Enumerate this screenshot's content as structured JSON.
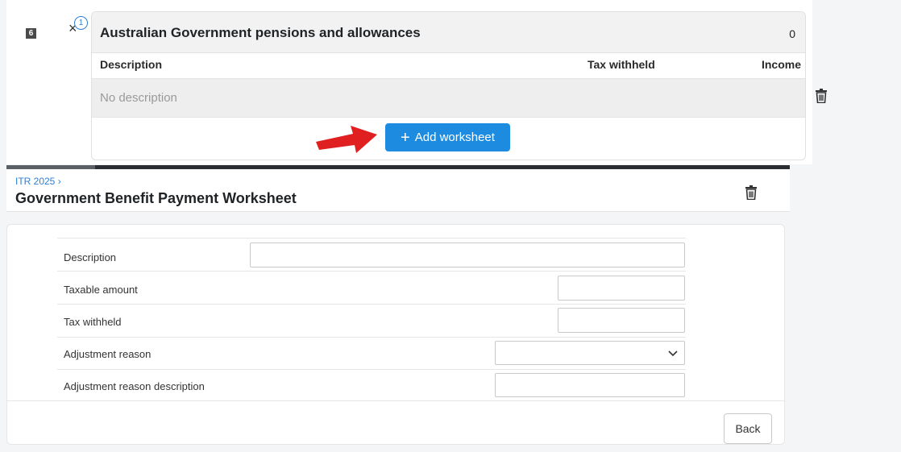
{
  "section": {
    "row_number": "6",
    "x_mark": "×",
    "badge_count": "1",
    "title": "Australian Government pensions and allowances",
    "total": "0",
    "columns": [
      "Description",
      "Tax withheld",
      "Income"
    ],
    "empty_text": "No description",
    "add_button": "+ Add worksheet",
    "add_button_plus": "+",
    "add_button_text": "Add worksheet"
  },
  "worksheet": {
    "breadcrumb": "ITR 2025 ›",
    "title": "Government Benefit Payment Worksheet",
    "fields": [
      {
        "label": "Description",
        "value": ""
      },
      {
        "label": "Taxable amount",
        "value": ""
      },
      {
        "label": "Tax withheld",
        "value": ""
      },
      {
        "label": "Adjustment reason",
        "value": ""
      },
      {
        "label": "Adjustment reason description",
        "value": ""
      }
    ],
    "back_button": "Back"
  },
  "colors": {
    "primary": "#1d8ce0",
    "arrow": "#e02020",
    "link": "#2f7fd0"
  },
  "icons": {
    "trash": "trash-icon",
    "arrow": "red-arrow-icon",
    "chevron": "chevron-down-icon"
  }
}
